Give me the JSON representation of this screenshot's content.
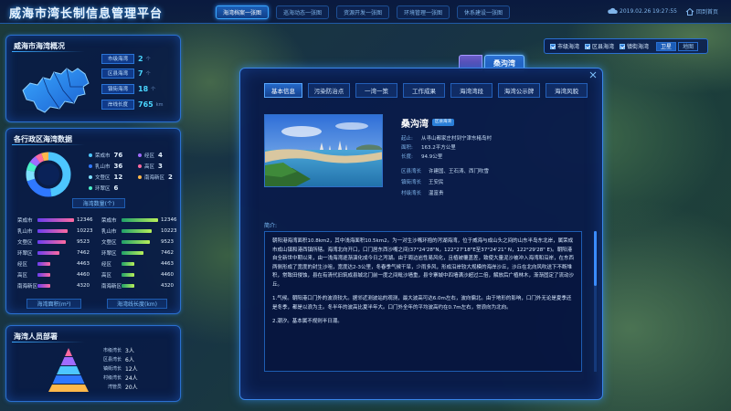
{
  "header": {
    "title": "威海市湾长制信息管理平台",
    "nav": [
      "海湾档案一张图",
      "巡海动态一张图",
      "资源开发一张图",
      "环境管理一张图",
      "休系建设一张图"
    ],
    "active_nav": "海湾档案一张图",
    "date": "2019.02.26",
    "time": "19:27:55",
    "home_label": "回到首页"
  },
  "overview": {
    "title": "威海市海湾概况",
    "items": [
      {
        "label": "市级海湾",
        "value": "2",
        "unit": "个"
      },
      {
        "label": "区县海湾",
        "value": "7",
        "unit": "个"
      },
      {
        "label": "镇街海湾",
        "value": "18",
        "unit": "个"
      },
      {
        "label": "岸线长度",
        "value": "765",
        "unit": "km"
      }
    ]
  },
  "district": {
    "title": "各行政区海湾数据",
    "donut_legend": [
      {
        "name": "荣成市",
        "value": "76",
        "color": "#4dc6ff"
      },
      {
        "name": "经区",
        "value": "4",
        "color": "#a06bff"
      },
      {
        "name": "乳山市",
        "value": "36",
        "color": "#2f78ff"
      },
      {
        "name": "高区",
        "value": "3",
        "color": "#ff6aa0"
      },
      {
        "name": "文登区",
        "value": "12",
        "color": "#7ee0ff"
      },
      {
        "name": "南海新区",
        "value": "2",
        "color": "#ffb84a"
      },
      {
        "name": "环翠区",
        "value": "6",
        "color": "#4af0c8"
      }
    ],
    "donut_caption": "海湾数量(个)",
    "area_caption": "海湾面积(m²)",
    "shore_caption": "海湾线长度(km)",
    "area_bars": [
      {
        "name": "荣成市",
        "value": "12346",
        "ratio": 1.0
      },
      {
        "name": "乳山市",
        "value": "10223",
        "ratio": 0.83
      },
      {
        "name": "文登区",
        "value": "9523",
        "ratio": 0.77
      },
      {
        "name": "环翠区",
        "value": "7462",
        "ratio": 0.6
      },
      {
        "name": "经区",
        "value": "4463",
        "ratio": 0.36
      },
      {
        "name": "高区",
        "value": "4460",
        "ratio": 0.36
      },
      {
        "name": "南海新区",
        "value": "4320",
        "ratio": 0.35
      }
    ],
    "shore_bars": [
      {
        "name": "荣成市",
        "value": "12346",
        "ratio": 1.0
      },
      {
        "name": "乳山市",
        "value": "10223",
        "ratio": 0.83
      },
      {
        "name": "文登区",
        "value": "9523",
        "ratio": 0.77
      },
      {
        "name": "环翠区",
        "value": "7462",
        "ratio": 0.6
      },
      {
        "name": "经区",
        "value": "4463",
        "ratio": 0.36
      },
      {
        "name": "高区",
        "value": "4460",
        "ratio": 0.36
      },
      {
        "name": "南海新区",
        "value": "4320",
        "ratio": 0.35
      }
    ]
  },
  "staff": {
    "title": "海湾人员部署",
    "rows": [
      {
        "label": "市级湾长",
        "count": "3人"
      },
      {
        "label": "区县湾长",
        "count": "6人"
      },
      {
        "label": "镇街湾长",
        "count": "12人"
      },
      {
        "label": "村级湾长",
        "count": "24人"
      },
      {
        "label": "湾管员",
        "count": "20人"
      }
    ]
  },
  "layers": {
    "checks": [
      "市级海湾",
      "区县海湾",
      "镇街海湾"
    ],
    "map_buttons": [
      "卫星",
      "地图"
    ],
    "active_map": "卫星"
  },
  "marker": {
    "label": "桑沟湾"
  },
  "dialog": {
    "tabs": [
      "基本信息",
      "污染防治点",
      "一湾一策",
      "工作成果",
      "海湾湾段",
      "海湾公示牌",
      "海湾风貌"
    ],
    "active_tab": "基本信息",
    "bay_name": "桑沟湾",
    "badge": "区县海湾",
    "info": [
      {
        "key": "起止:",
        "value": "从寻山都家庄村到宁津东楮岛村"
      },
      {
        "key": "面积:",
        "value": "163.2平方公里"
      },
      {
        "key": "长度:",
        "value": "94.9公里"
      }
    ],
    "officers": [
      {
        "key": "区县湾长",
        "value": "许建国、王石涛、西门吹雪"
      },
      {
        "key": "镇街湾长",
        "value": "王安民"
      },
      {
        "key": "村级湾长",
        "value": "温富贵"
      }
    ],
    "intro_label": "简介:",
    "intro_paragraphs": [
      "朝阳港海湾面积10.8km2，其中浅海面积10.5km2。为一对生沙嘴环抱的泻湖海湾，位于威海与成山头之间的山东半岛东北岸，属荣成市成山镇和港西镇所辖。海湾北向开口，口门居东西沙嘴之间(37°24'28\"N，122°27'18\"E至37°24'21\" N，122°29'28\" E)。朝阳港自全新世中期以来，由一浅海湾逐渐演化成今日之泻湖。由于周边岩性易风化，且植被覆盖差，致使大量泥沙被冲入海湾和沿岸，在东西两侧形成了宽度的封生沙咀，宽度达2-3公里，冬春季气候干旱，少雨多风，形成沿岸较大规模的海岸沙丘，沙丘在北向风吹送下不断堆积，常致田侵蚀，县在有清代旧筑成县城北门前一度之间毗沙墙重，县令寨城中四墙满沙超过二倍，解放后广植林木，渐渐固定了流动沙丘。",
      "1.气候。朝阳港口门外的波浪较大。据邻近测波站的观测，最大波高可达6.0m左右，波向偏北。由于地形的影响，口门外无论是夏季还是冬季，都是以浪为主。冬半年的波高比夏半年大。口门外全年的平均波高约在0.7m左右，常浪向为北向。",
      "2.潮汐。基本属不规则半日潮。"
    ]
  }
}
